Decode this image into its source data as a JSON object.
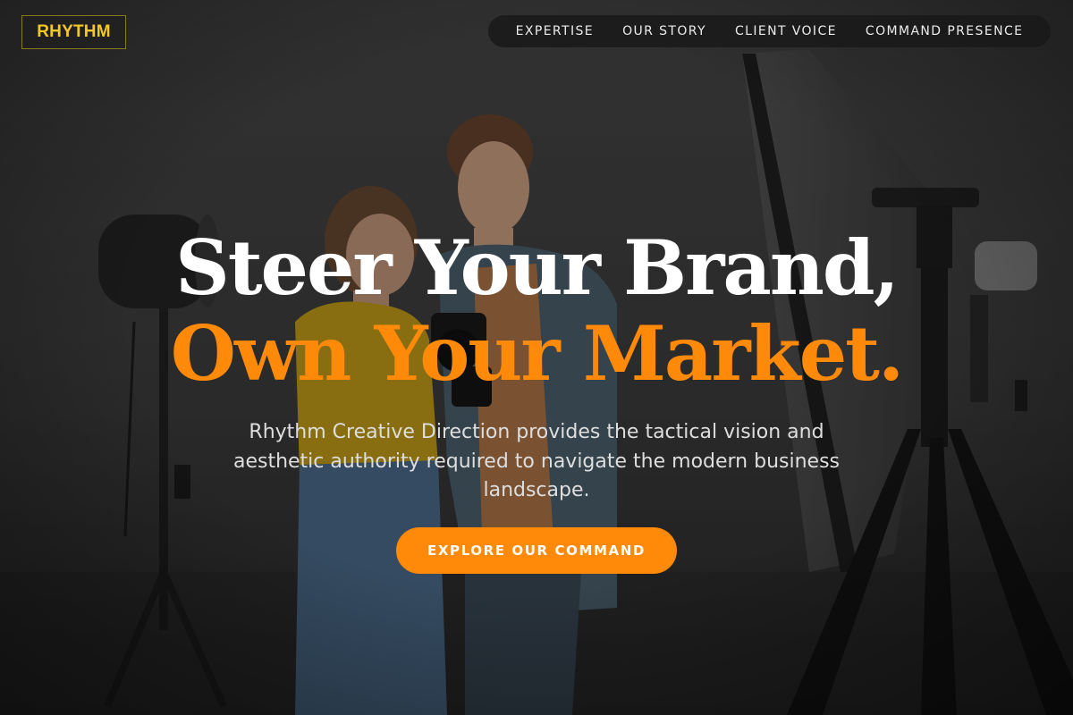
{
  "brand": {
    "logo_text": "RHYTHM",
    "accent_color": "#f2c924"
  },
  "nav": {
    "items": [
      {
        "label": "EXPERTISE"
      },
      {
        "label": "OUR STORY"
      },
      {
        "label": "CLIENT VOICE"
      },
      {
        "label": "COMMAND PRESENCE"
      }
    ]
  },
  "hero": {
    "title_line1": "Steer Your Brand,",
    "title_line2": "Own Your Market.",
    "subtitle": "Rhythm Creative Direction provides the tactical vision and aesthetic authority required to navigate the modern business landscape.",
    "cta_label": "EXPLORE OUR COMMAND",
    "highlight_color": "#ff8a0a"
  },
  "background": {
    "description_icon": "photo-studio-image"
  }
}
